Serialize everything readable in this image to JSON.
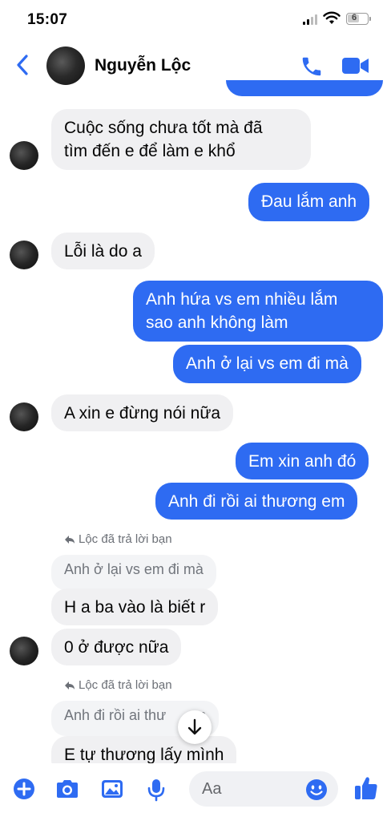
{
  "status_bar": {
    "time": "15:07",
    "battery": "6"
  },
  "header": {
    "contact_name": "Nguyễn Lộc"
  },
  "messages": {
    "m1": "Cuộc sống chưa tốt mà đã",
    "m1b": "tìm đến e để làm e khổ",
    "m2": "Đau lắm anh",
    "m3": "Lỗi là do a",
    "m4": "Anh hứa vs em nhiều lắm",
    "m4b": "sao anh không làm",
    "m5": "Anh ở lại vs em đi mà",
    "m6": "A xin e đừng nói nữa",
    "m7": "Em xin anh đó",
    "m8": "Anh đi rồi ai thương em",
    "reply1_meta": "Lộc đã trả lời bạn",
    "reply1_quote": "Anh ở lại vs em đi mà",
    "m9": "H a ba vào là biết r",
    "m10": "0 ở được nữa",
    "reply2_meta": "Lộc đã trả lời bạn",
    "reply2_quote": "Anh đi rồi ai thư     em",
    "m11": "E tự thương lấy mình"
  },
  "composer": {
    "placeholder": "Aa"
  },
  "icons": [
    "back-chevron-icon",
    "phone-icon",
    "video-icon",
    "reply-arrow-icon",
    "arrow-down-icon",
    "plus-icon",
    "camera-icon",
    "image-icon",
    "microphone-icon",
    "emoji-icon",
    "thumbs-up-icon"
  ],
  "colors": {
    "accent": "#2e6bf2",
    "incoming_bubble": "#f0f0f2"
  }
}
